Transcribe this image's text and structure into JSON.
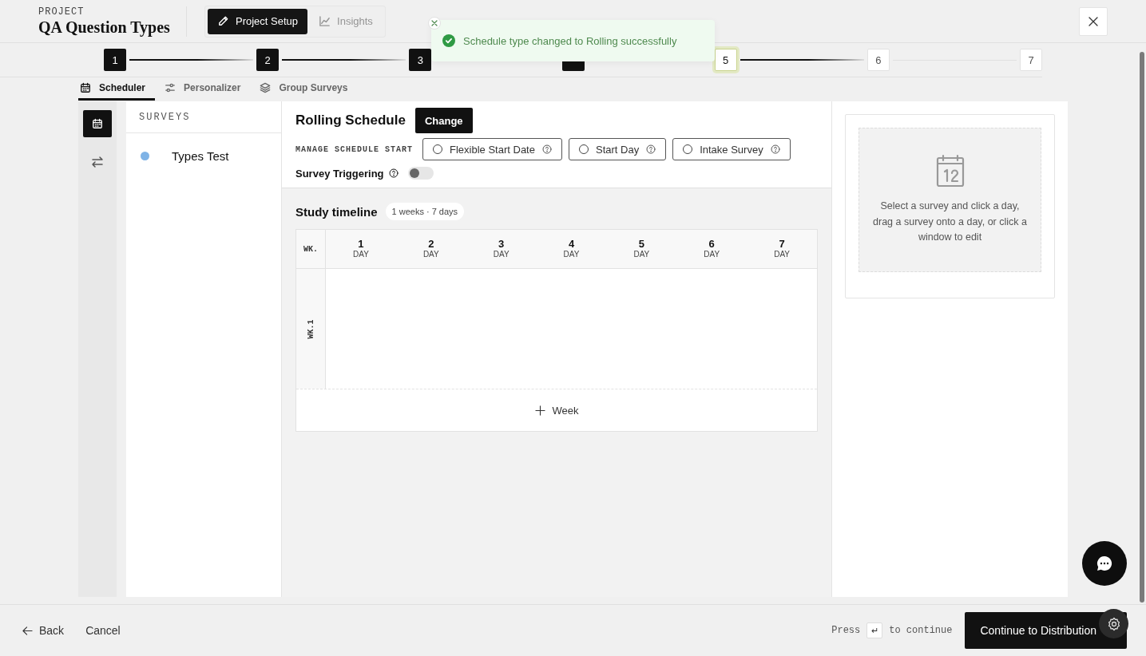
{
  "header": {
    "eyebrow": "PROJECT",
    "title": "QA Question Types",
    "mode_tabs": [
      {
        "label": "Project Setup",
        "kind": "pencil",
        "selected": true,
        "disabled": false
      },
      {
        "label": "Insights",
        "kind": "chart",
        "selected": false,
        "disabled": true
      }
    ]
  },
  "toast": {
    "message": "Schedule type changed to Rolling successfully"
  },
  "stepper": [
    {
      "label": "1",
      "completed": true,
      "selected": false
    },
    {
      "label": "2",
      "completed": true,
      "selected": false
    },
    {
      "label": "3",
      "completed": true,
      "selected": false
    },
    {
      "completed": true,
      "selected": false
    },
    {
      "label": "5",
      "completed": false,
      "selected": true
    },
    {
      "label": "6",
      "completed": false,
      "selected": false
    },
    {
      "label": "7",
      "completed": false,
      "selected": false
    }
  ],
  "sub_tabs": [
    {
      "label": "Scheduler",
      "kind": "calendar",
      "selected": true
    },
    {
      "label": "Personalizer",
      "kind": "sliders",
      "selected": false
    },
    {
      "label": "Group Surveys",
      "kind": "layers",
      "selected": false
    }
  ],
  "rail": [
    {
      "kind": "calendar",
      "selected": true
    },
    {
      "kind": "swap",
      "selected": false
    }
  ],
  "surveys": {
    "heading": "SURVEYS",
    "items": [
      {
        "name": "Types Test",
        "color": "#7fb3e6"
      }
    ]
  },
  "schedule": {
    "title": "Rolling Schedule",
    "change_button": "Change",
    "start_label": "MANAGE SCHEDULE START",
    "start_options": [
      {
        "label": "Flexible Start Date",
        "selected": false
      },
      {
        "label": "Start Day",
        "selected": false
      },
      {
        "label": "Intake Survey",
        "selected": false
      }
    ],
    "triggering": {
      "label": "Survey Triggering",
      "on": false
    }
  },
  "timeline": {
    "title": "Study timeline",
    "badge": "1 weeks · 7 days",
    "week_header": "WK.",
    "days": [
      {
        "number": "1",
        "unit": "DAY"
      },
      {
        "number": "2",
        "unit": "DAY"
      },
      {
        "number": "3",
        "unit": "DAY"
      },
      {
        "number": "4",
        "unit": "DAY"
      },
      {
        "number": "5",
        "unit": "DAY"
      },
      {
        "number": "6",
        "unit": "DAY"
      },
      {
        "number": "7",
        "unit": "DAY"
      }
    ],
    "weeks": [
      {
        "label": "WK.1"
      }
    ],
    "add_week": "Week"
  },
  "hint": {
    "text": "Select a survey and click a day, drag a survey onto a day, or click a window to edit"
  },
  "footer": {
    "back": "Back",
    "cancel": "Cancel",
    "press": "Press",
    "key": "↵",
    "to_continue": "to continue",
    "continue": "Continue to Distribution"
  }
}
